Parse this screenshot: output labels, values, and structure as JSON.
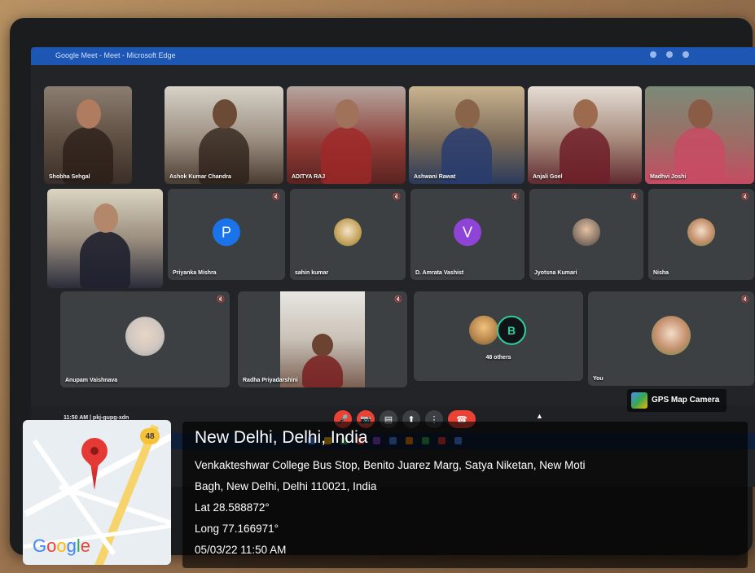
{
  "window": {
    "title": "Google Meet - Meet - Microsoft Edge"
  },
  "participants": [
    {
      "name": "Shobha Sehgal"
    },
    {
      "name": "Ashok Kumar Chandra"
    },
    {
      "name": "ADITYA RAJ"
    },
    {
      "name": "Ashwani Rawat"
    },
    {
      "name": "Anjali Goel"
    },
    {
      "name": "Madhvi Joshi"
    },
    {
      "name": ""
    },
    {
      "name": "Priyanka Mishra",
      "initial": "P"
    },
    {
      "name": "sahin kumar"
    },
    {
      "name": "D. Amrata Vashist",
      "initial": "V"
    },
    {
      "name": "Jyotsna Kumari"
    },
    {
      "name": "Nisha"
    },
    {
      "name": "Anupam Vaishnava"
    },
    {
      "name": "Radha Priyadarshini"
    },
    {
      "name": "48 others"
    },
    {
      "name": "You"
    }
  ],
  "bottom_bar": {
    "meeting_info": "11:50 AM | pkj-gupg-xdn",
    "controls": {
      "mic": "mic-off-icon",
      "camera": "camera-off-icon",
      "captions": "captions-icon",
      "present": "present-icon",
      "more": "more-options-icon",
      "end": "end-call-icon"
    }
  },
  "watermark": {
    "label": "GPS Map Camera"
  },
  "location": {
    "city": "New Delhi, Delhi, India",
    "address_line1": "Venkakteshwar College Bus Stop, Benito Juarez Marg, Satya Niketan, New Moti",
    "address_line2": "Bagh, New Delhi, Delhi 110021, India",
    "lat": "Lat 28.588872°",
    "long": "Long 77.166971°",
    "datetime": "05/03/22 11:50 AM"
  },
  "map": {
    "route_shield": "48",
    "logo": "Google"
  },
  "colors": {
    "meet_red": "#ea4335",
    "tile_bg": "#3c4043",
    "titlebar": "#1d56b3"
  }
}
